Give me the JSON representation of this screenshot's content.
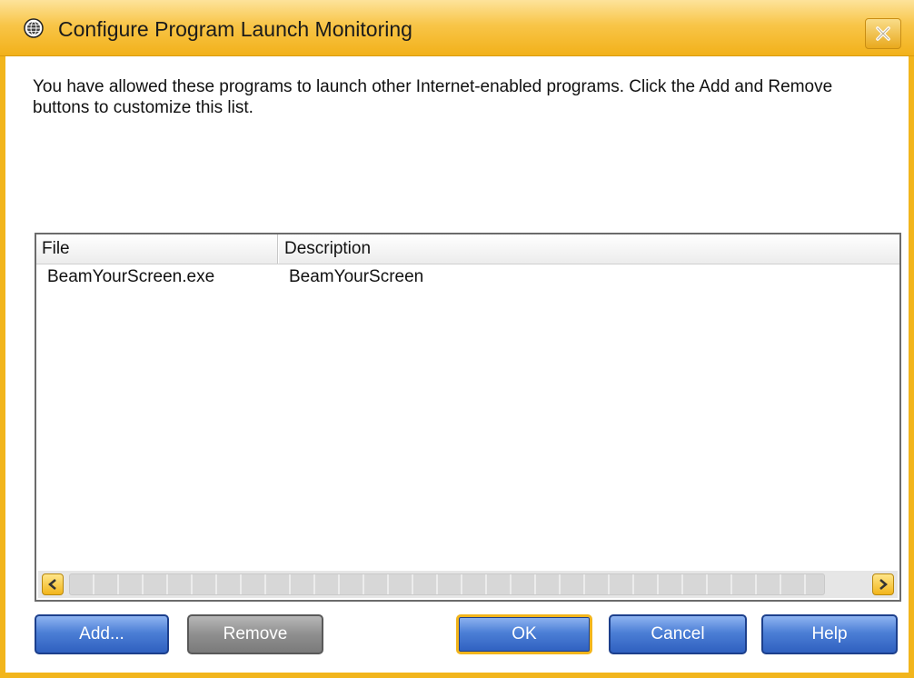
{
  "window": {
    "title": "Configure Program Launch Monitoring",
    "accent_color": "#f2b51c",
    "title_icon": "globe-icon",
    "close_icon": "close-icon"
  },
  "instructions": "You have allowed these programs to launch other Internet-enabled programs. Click the Add and Remove buttons to customize this list.",
  "list": {
    "columns": [
      "File",
      "Description"
    ],
    "rows": [
      {
        "file": "BeamYourScreen.exe",
        "description": "BeamYourScreen"
      }
    ]
  },
  "buttons": {
    "add": "Add...",
    "remove": "Remove",
    "ok": "OK",
    "cancel": "Cancel",
    "help": "Help"
  }
}
